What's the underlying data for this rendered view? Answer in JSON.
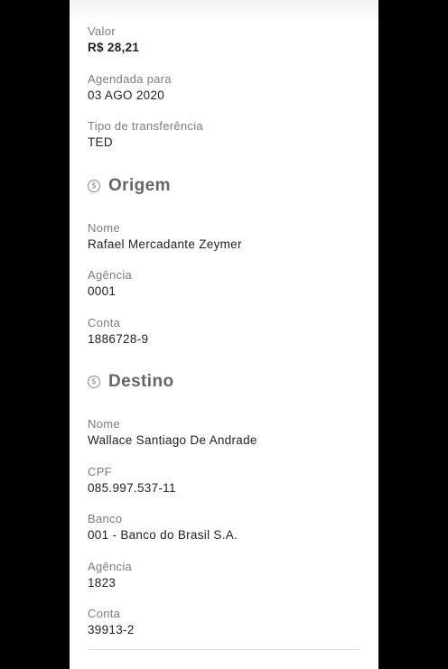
{
  "transfer": {
    "valor": {
      "label": "Valor",
      "value": "R$ 28,21"
    },
    "agendada": {
      "label": "Agendada para",
      "value": "03 AGO 2020"
    },
    "tipo": {
      "label": "Tipo de transferência",
      "value": "TED"
    }
  },
  "origem": {
    "title": "Origem",
    "icon": "dollar-coin-icon",
    "nome": {
      "label": "Nome",
      "value": "Rafael Mercadante Zeymer"
    },
    "agencia": {
      "label": "Agência",
      "value": "0001"
    },
    "conta": {
      "label": "Conta",
      "value": "1886728-9"
    }
  },
  "destino": {
    "title": "Destino",
    "icon": "dollar-coin-icon",
    "nome": {
      "label": "Nome",
      "value": "Wallace Santiago De Andrade"
    },
    "cpf": {
      "label": "CPF",
      "value": "085.997.537-11"
    },
    "banco": {
      "label": "Banco",
      "value": "001 - Banco do Brasil S.A."
    },
    "agencia": {
      "label": "Agência",
      "value": "1823"
    },
    "conta": {
      "label": "Conta",
      "value": "39913-2"
    }
  },
  "colors": {
    "background": "#000000",
    "card": "#ffffff",
    "label": "#7b7b7b",
    "value": "#222222",
    "section_title": "#666666"
  }
}
